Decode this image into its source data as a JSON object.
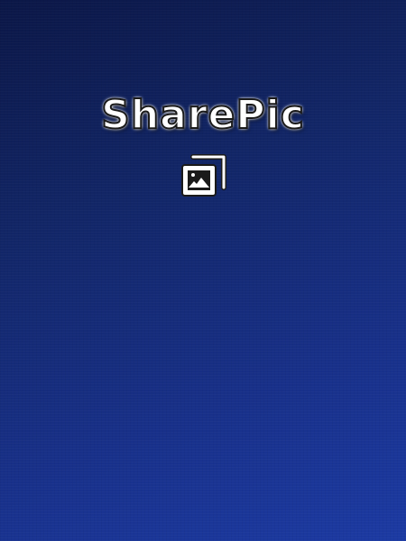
{
  "app": {
    "title": "SharePic",
    "logo_icon": "gallery-icon"
  },
  "colors": {
    "background_top": "#0b1747",
    "background_bottom": "#1c3aa3",
    "title_fill": "#ffffff",
    "title_outline": "#1a1a1a"
  }
}
